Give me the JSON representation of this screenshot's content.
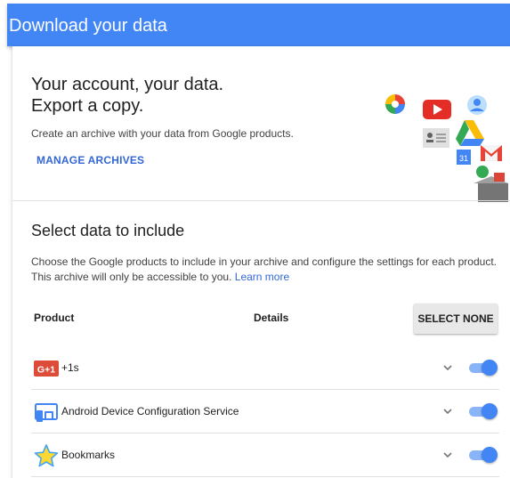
{
  "appbar": {
    "title": "Download your data"
  },
  "hero": {
    "title_line1": "Your account, your data.",
    "title_line2": "Export a copy.",
    "description": "Create an archive with your data from Google products.",
    "manage_label": "MANAGE ARCHIVES",
    "calendar_number": "31"
  },
  "select_section": {
    "title": "Select data to include",
    "description_line1": "Choose the Google products to include in your archive and configure the settings for each product.",
    "description_line2": "This archive will only be accessible to you.",
    "learn_more": "Learn more"
  },
  "table": {
    "header_product": "Product",
    "header_details": "Details",
    "select_none_label": "SELECT NONE",
    "rows": [
      {
        "icon": "google-plus-one-icon",
        "icon_text": "G+1",
        "label": "+1s",
        "enabled": true
      },
      {
        "icon": "android-device-icon",
        "label": "Android Device Configuration Service",
        "enabled": true
      },
      {
        "icon": "star-icon",
        "label": "Bookmarks",
        "enabled": true
      }
    ]
  },
  "colors": {
    "appbar": "#4285f4",
    "link": "#3367d6",
    "toggle_track": "#8ab4f8",
    "toggle_thumb": "#4285f4",
    "gplus_red": "#dd4b39"
  }
}
